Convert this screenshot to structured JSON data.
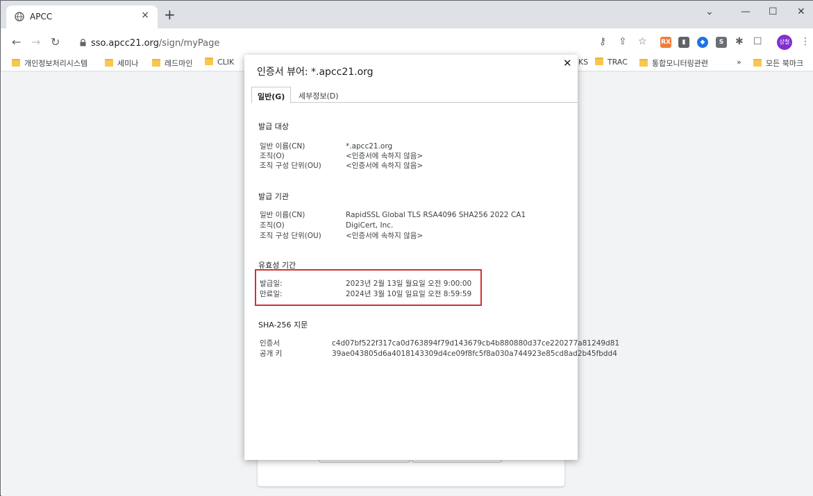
{
  "browser": {
    "tab_title": "APCC",
    "tab_close": "×",
    "new_tab": "+",
    "window_controls": [
      "⌄",
      "—",
      "☐",
      "✕"
    ],
    "url_host": "sso.apcc21.org",
    "url_path": "/sign/myPage",
    "profile_label": "상철"
  },
  "bookmarks": [
    "개인정보처리시스템",
    "세미나",
    "레드마인",
    "CLIK",
    "KS",
    "TRAC",
    "통합모니터링관련",
    "모든 북마크"
  ],
  "bookmarks_more": "»",
  "dialog": {
    "title": "인증서 뷰어: *.apcc21.org",
    "close": "✕",
    "tabs": [
      "일반(G)",
      "세부정보(D)"
    ],
    "issued_to": {
      "heading": "발급 대상",
      "rows": [
        {
          "k": "일반 이름(CN)",
          "v": "*.apcc21.org"
        },
        {
          "k": "조직(O)",
          "v": "<인증서에 속하지 않음>"
        },
        {
          "k": "조직 구성 단위(OU)",
          "v": "<인증서에 속하지 않음>"
        }
      ]
    },
    "issued_by": {
      "heading": "발급 기관",
      "rows": [
        {
          "k": "일반 이름(CN)",
          "v": "RapidSSL Global TLS RSA4096 SHA256 2022 CA1"
        },
        {
          "k": "조직(O)",
          "v": "DigiCert, Inc."
        },
        {
          "k": "조직 구성 단위(OU)",
          "v": "<인증서에 속하지 않음>"
        }
      ]
    },
    "validity": {
      "heading": "유효성 기간",
      "rows": [
        {
          "k": "발급일:",
          "v": "2023년 2월 13일 월요일 오전 9:00:00"
        },
        {
          "k": "만료일:",
          "v": "2024년 3월 10일 일요일 오전 8:59:59"
        }
      ]
    },
    "fingerprint": {
      "heading": "SHA-256 지문",
      "rows": [
        {
          "k": "인증서",
          "v": "c4d07bf522f317ca0d763894f79d143679cb4b880880d37ce220277a81249d81"
        },
        {
          "k": "공개 키",
          "v": "39ae043805d6a4018143309d4ce09f8fc5f8a030a744923e85cd8ad2b45fbdd4"
        }
      ]
    }
  },
  "colors": {
    "highlight": "#d32f2f",
    "profile": "#8430ce"
  }
}
